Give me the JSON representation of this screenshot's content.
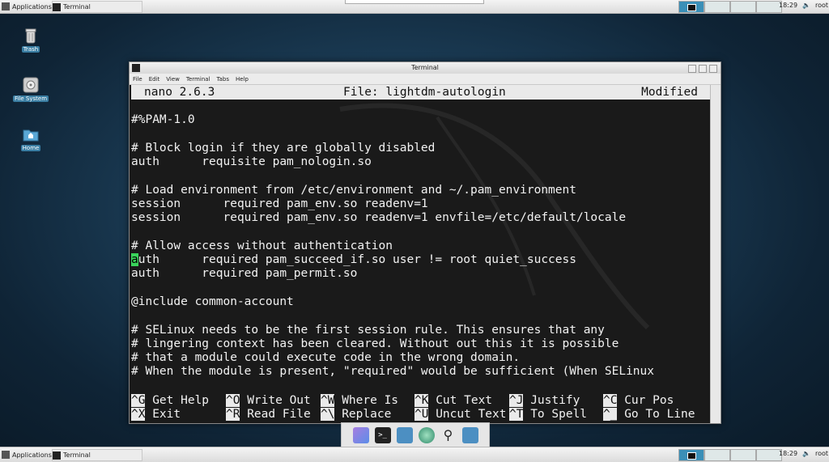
{
  "top_panel": {
    "applications": "Applications",
    "task": "Terminal",
    "clock": "18:29",
    "user": "root"
  },
  "bottom_panel": {
    "applications": "Applications",
    "task": "Terminal",
    "clock": "18:29",
    "user": "root"
  },
  "desktop_icons": [
    {
      "label": "Trash",
      "icon": "trash-icon"
    },
    {
      "label": "File System",
      "icon": "drive-icon"
    },
    {
      "label": "Home",
      "icon": "home-folder-icon"
    }
  ],
  "window": {
    "title": "Terminal",
    "menu": [
      "File",
      "Edit",
      "View",
      "Terminal",
      "Tabs",
      "Help"
    ]
  },
  "nano": {
    "version": "nano 2.6.3",
    "file": "File: lightdm-autologin",
    "status": "Modified",
    "lines": [
      "#%PAM-1.0",
      "",
      "# Block login if they are globally disabled",
      "auth      requisite pam_nologin.so",
      "",
      "# Load environment from /etc/environment and ~/.pam_environment",
      "session      required pam_env.so readenv=1",
      "session      required pam_env.so readenv=1 envfile=/etc/default/locale",
      "",
      "# Allow access without authentication",
      "auth      required pam_succeed_if.so user != root quiet_success",
      "auth      required pam_permit.so",
      "",
      "@include common-account",
      "",
      "# SELinux needs to be the first session rule. This ensures that any",
      "# lingering context has been cleared. Without out this it is possible",
      "# that a module could execute code in the wrong domain.",
      "# When the module is present, \"required\" would be sufficient (When SELinux"
    ],
    "cursor_line": {
      "cursor_char": "a",
      "rest": "uth      required pam_succeed_if.so user != root quiet_success"
    },
    "shortcuts_row1": [
      {
        "key": "^G",
        "label": "Get Help"
      },
      {
        "key": "^O",
        "label": "Write Out"
      },
      {
        "key": "^W",
        "label": "Where Is"
      },
      {
        "key": "^K",
        "label": "Cut Text"
      },
      {
        "key": "^J",
        "label": "Justify"
      },
      {
        "key": "^C",
        "label": "Cur Pos"
      }
    ],
    "shortcuts_row2": [
      {
        "key": "^X",
        "label": "Exit"
      },
      {
        "key": "^R",
        "label": "Read File"
      },
      {
        "key": "^\\",
        "label": "Replace"
      },
      {
        "key": "^U",
        "label": "Uncut Text"
      },
      {
        "key": "^T",
        "label": "To Spell"
      },
      {
        "key": "^_",
        "label": "Go To Line"
      }
    ]
  },
  "dock": [
    "files-icon",
    "terminal-icon",
    "folder-icon",
    "browser-icon",
    "search-icon",
    "folder-icon"
  ],
  "colors": {
    "accent": "#3a8fb7",
    "cursor": "#39d45a"
  }
}
